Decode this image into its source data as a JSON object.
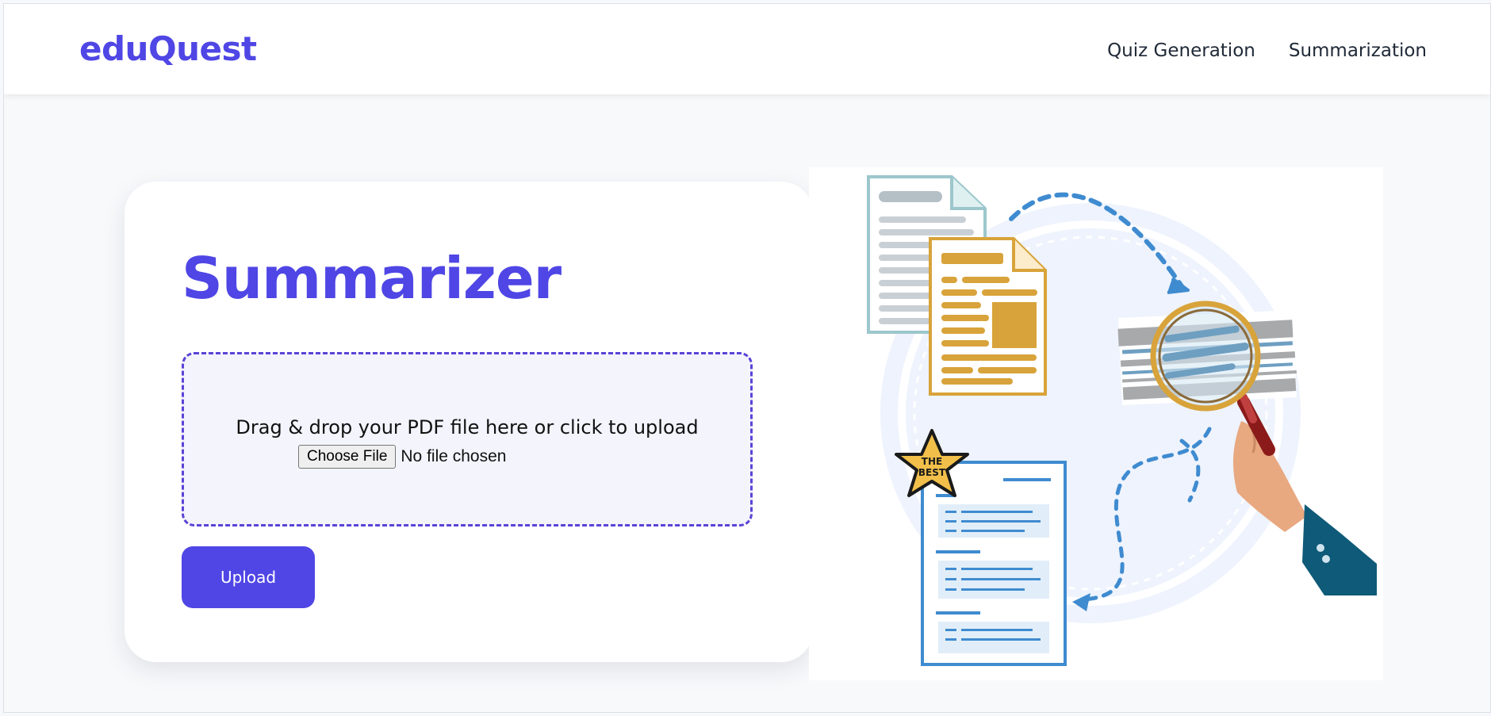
{
  "app": {
    "brand": "eduQuest"
  },
  "nav": {
    "links": [
      "Quiz Generation",
      "Summarization"
    ]
  },
  "summarizer": {
    "title": "Summarizer",
    "drop_text": "Drag & drop your PDF file here or click to upload",
    "choose_file_label": "Choose File",
    "file_status": "No file chosen",
    "upload_label": "Upload"
  },
  "illustration": {
    "badge_line1": "THE",
    "badge_line2": "BEST"
  },
  "colors": {
    "accent": "#4f46e5",
    "doc_yellow": "#d8a33a",
    "doc_blue": "#3f8bd0",
    "doc_teal": "#9cc7cc",
    "hand": "#e8a880",
    "sleeve": "#0e5a78"
  }
}
